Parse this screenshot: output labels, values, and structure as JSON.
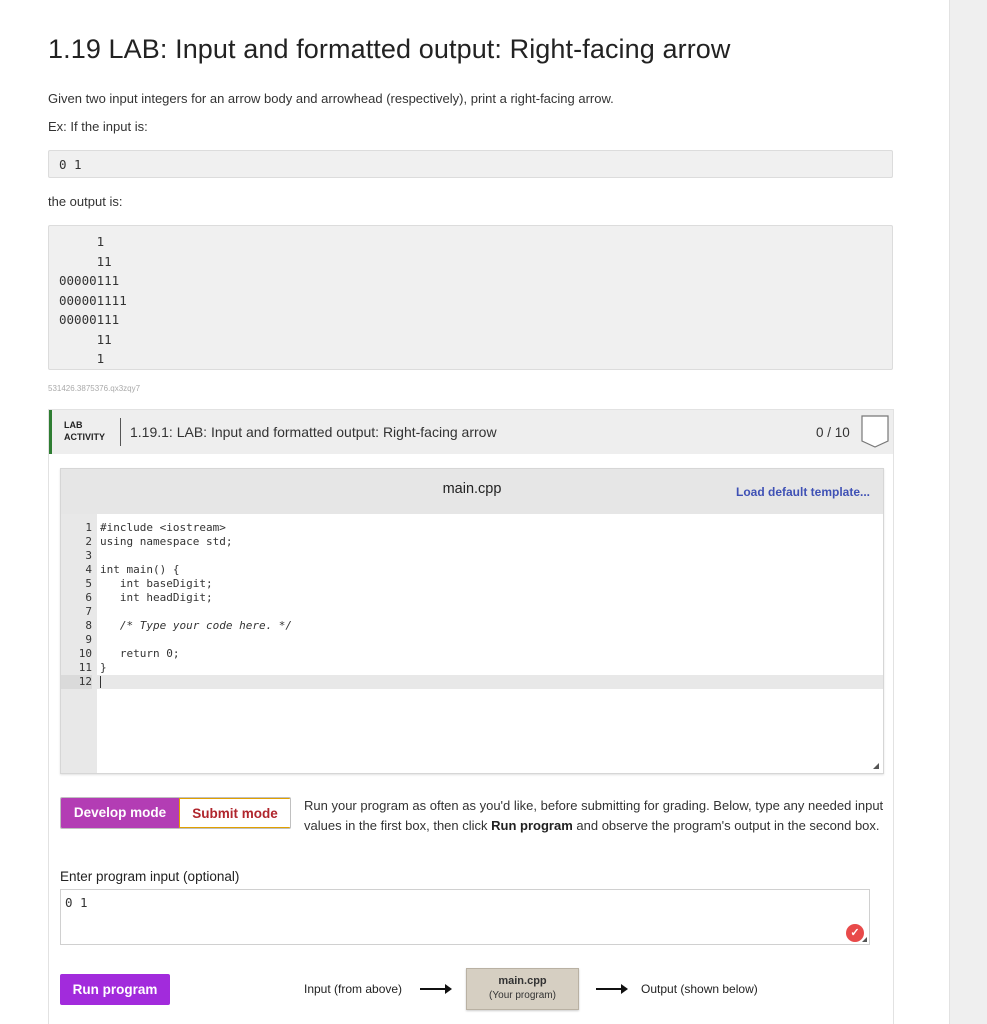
{
  "title": "1.19 LAB: Input and formatted output: Right-facing arrow",
  "description": "Given two input integers for an arrow body and arrowhead (respectively), print a right-facing arrow.",
  "example_intro": "Ex: If the input is:",
  "example_input": "0 1",
  "output_intro": "the output is:",
  "example_output": [
    "     1",
    "     11",
    "00000111",
    "000001111",
    "00000111",
    "     11",
    "     1"
  ],
  "lab_id": "531426.3875376.qx3zqy7",
  "lab": {
    "tag_line1": "LAB",
    "tag_line2": "ACTIVITY",
    "name": "1.19.1: LAB: Input and formatted output: Right-facing arrow",
    "score": "0 / 10"
  },
  "editor": {
    "filename": "main.cpp",
    "load_template": "Load default template...",
    "line_numbers": [
      "1",
      "2",
      "3",
      "4",
      "5",
      "6",
      "7",
      "8",
      "9",
      "10",
      "11",
      "12"
    ],
    "lines": [
      "#include <iostream>",
      "using namespace std;",
      "",
      "int main() {",
      "   int baseDigit;",
      "   int headDigit;",
      "",
      "   /* Type your code here. */",
      "",
      "   return 0;",
      "}",
      ""
    ]
  },
  "modes": {
    "develop": "Develop mode",
    "submit": "Submit mode",
    "desc_before": "Run your program as often as you'd like, before submitting for grading. Below, type any needed input values in the first box, then click ",
    "desc_bold": "Run program",
    "desc_after": " and observe the program's output in the second box."
  },
  "program_input": {
    "label": "Enter program input (optional)",
    "value": "0 1"
  },
  "run": {
    "button": "Run program",
    "flow_input": "Input (from above)",
    "program_name": "main.cpp",
    "program_sub": "(Your program)",
    "flow_output": "Output (shown below)"
  },
  "colors": {
    "develop": "#b33db4",
    "submit_text": "#b0252c",
    "run": "#a22bdc",
    "lab_accent": "#2e7d32",
    "link": "#3f51b5"
  }
}
